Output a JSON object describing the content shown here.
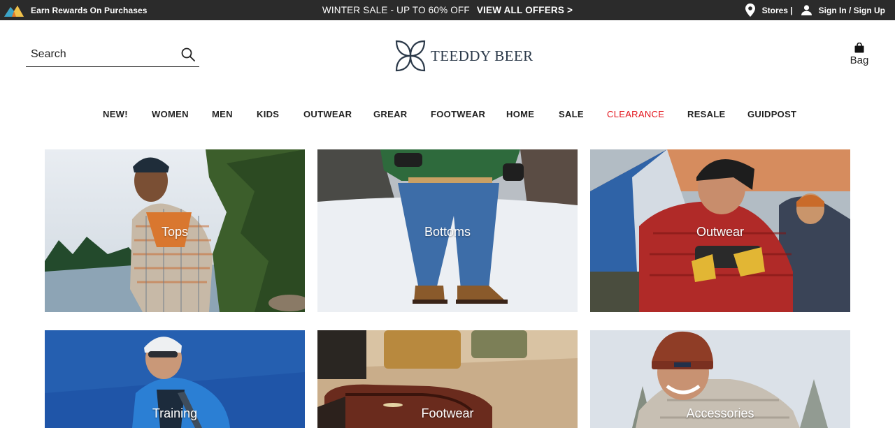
{
  "topbar": {
    "rewards_text": "Earn Rewards On Purchases",
    "sale_text": "WINTER SALE - UP TO 60% OFF",
    "offers_label": "VIEW ALL OFFERS >",
    "stores_label": "Stores |",
    "signin_label": "Sign In / Sign Up",
    "background": "#2b2b2b"
  },
  "header": {
    "search_placeholder": "Search",
    "logo_name": "TEEDDY BEER",
    "bag_label": "Bag"
  },
  "nav": {
    "items": [
      {
        "label": "NEW!"
      },
      {
        "label": "WOMEN"
      },
      {
        "label": "MEN"
      },
      {
        "label": "KIDS"
      },
      {
        "label": "OUTWEAR"
      },
      {
        "label": "GREAR"
      },
      {
        "label": "FOOTWEAR"
      },
      {
        "label": "HOME"
      },
      {
        "label": "SALE"
      },
      {
        "label": "CLEARANCE",
        "color": "#e3131b"
      },
      {
        "label": "RESALE"
      },
      {
        "label": "GUIDPOST"
      }
    ]
  },
  "categories": [
    {
      "label": "Tops"
    },
    {
      "label": "Bottoms"
    },
    {
      "label": "Outwear"
    },
    {
      "label": "Training"
    },
    {
      "label": "Footwear"
    },
    {
      "label": "Accessories"
    }
  ],
  "icons": {
    "rewards": "mountain-logo-icon",
    "stores": "map-pin-icon",
    "user": "user-icon",
    "search": "search-icon",
    "bag": "shopping-bag-icon"
  }
}
